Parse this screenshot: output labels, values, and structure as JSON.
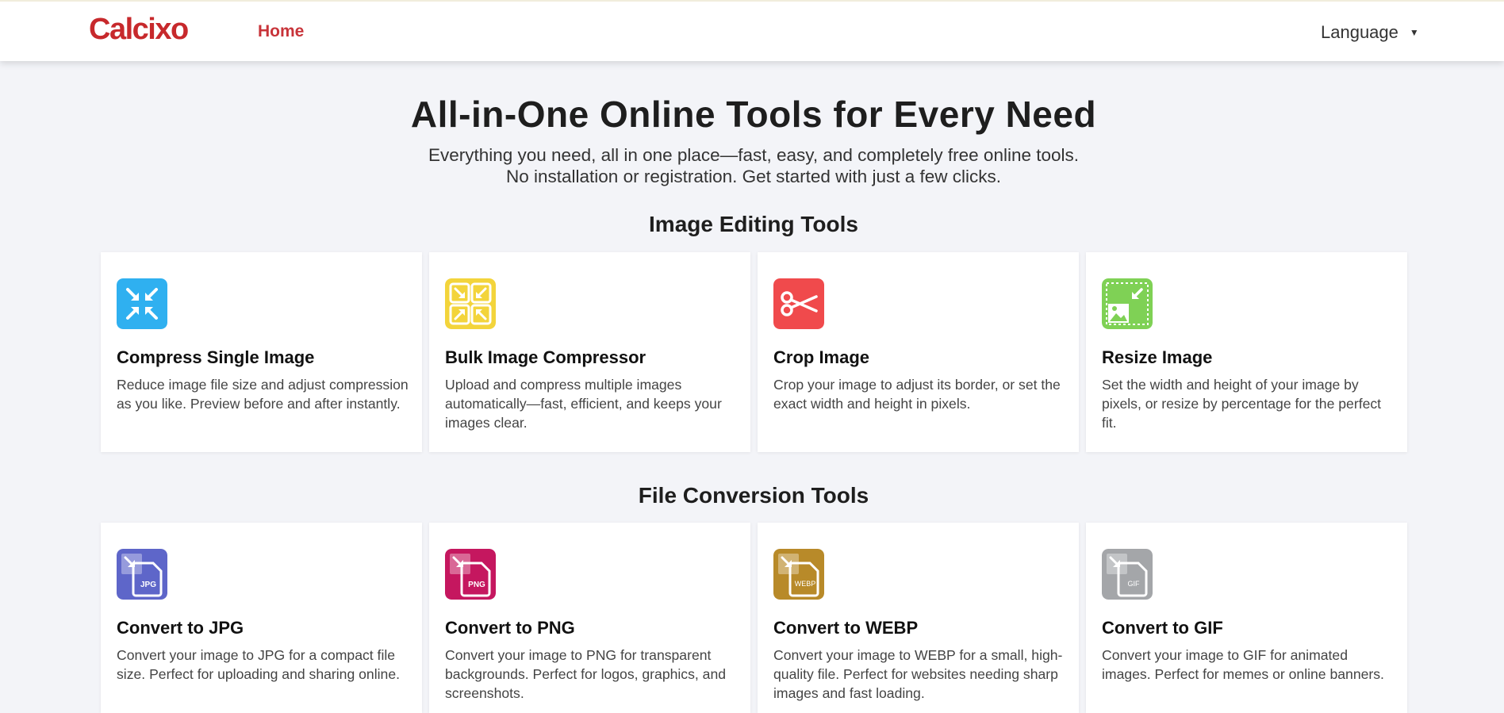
{
  "nav": {
    "logo": "Calcixo",
    "home": "Home",
    "language": "Language"
  },
  "hero": {
    "title": "All-in-One Online Tools for Every Need",
    "subtitle_line1": "Everything you need, all in one place—fast, easy, and completely free online tools.",
    "subtitle_line2": "No installation or registration. Get started with just a few clicks."
  },
  "sections": [
    {
      "title": "Image Editing Tools",
      "tools": [
        {
          "title": "Compress Single Image",
          "desc": "Reduce image file size and adjust compression as you like. Preview before and after instantly.",
          "icon": "compress-icon",
          "color": "#2fb0f0"
        },
        {
          "title": "Bulk Image Compressor",
          "desc": "Upload and compress multiple images automatically—fast, efficient, and keeps your images clear.",
          "icon": "bulk-compress-icon",
          "color": "#f3d43b"
        },
        {
          "title": "Crop Image",
          "desc": "Crop your image to adjust its border, or set the exact width and height in pixels.",
          "icon": "scissors-icon",
          "color": "#f04a4c"
        },
        {
          "title": "Resize Image",
          "desc": "Set the width and height of your image by pixels, or resize by percentage for the perfect fit.",
          "icon": "resize-image-icon",
          "color": "#7fd155"
        }
      ]
    },
    {
      "title": "File Conversion Tools",
      "tools": [
        {
          "title": "Convert to JPG",
          "desc": "Convert your image to JPG for a compact file size. Perfect for uploading and sharing online.",
          "icon": "jpg-file-icon",
          "badge": "JPG",
          "color": "#5e66c9"
        },
        {
          "title": "Convert to PNG",
          "desc": "Convert your image to PNG for transparent backgrounds. Perfect for logos, graphics, and screenshots.",
          "icon": "png-file-icon",
          "badge": "PNG",
          "color": "#c5175f"
        },
        {
          "title": "Convert to WEBP",
          "desc": "Convert your image to WEBP for a small, high-quality file. Perfect for websites needing sharp images and fast loading.",
          "icon": "webp-file-icon",
          "badge": "WEBP",
          "color": "#b88a29"
        },
        {
          "title": "Convert to GIF",
          "desc": "Convert your image to GIF for animated images. Perfect for memes or online banners.",
          "icon": "gif-file-icon",
          "badge": "GIF",
          "color": "#a4a6a9"
        }
      ]
    }
  ]
}
